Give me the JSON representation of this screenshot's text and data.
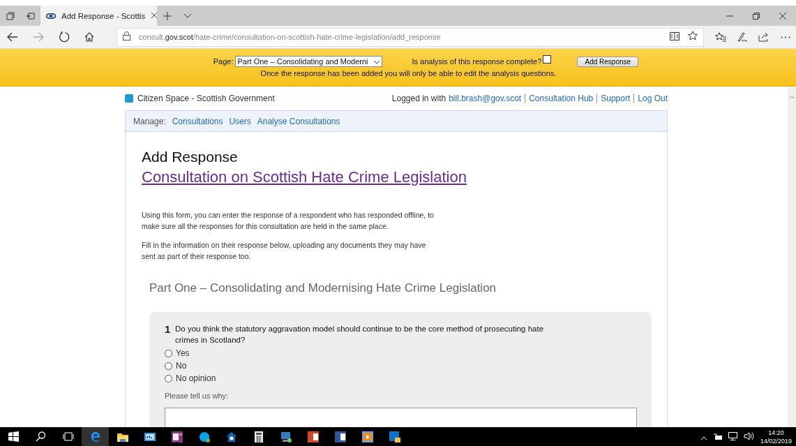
{
  "browser": {
    "tab": {
      "title": "Add Response - Scottis",
      "selected": true
    },
    "url": {
      "prefix": "consult.",
      "domain": "gov.scot",
      "path": "/hate-crime/consultation-on-scottish-hate-crime-legislation/add_response"
    }
  },
  "banner": {
    "page_label": "Page:",
    "page_select": "Part One – Consolidating and Moderni",
    "question": "Is analysis of this response complete?",
    "analysis_complete": false,
    "button": "Add Response",
    "note": "Once the response has been added you will only be able to edit the analysis questions."
  },
  "header": {
    "site": "Citizen Space - Scottish Government",
    "logged_in": "Logged in with",
    "user": "bill.brash@gov.scot",
    "links": [
      "Consultation Hub",
      "Support",
      "Log Out"
    ]
  },
  "manage": {
    "label": "Manage:",
    "links": [
      "Consultations",
      "Users",
      "Analyse Consultations"
    ]
  },
  "main": {
    "title": "Add Response",
    "consultation": "Consultation on Scottish Hate Crime Legislation",
    "paragraphs": [
      "Using this form, you can enter the response of a respondent who has responded offline, to make sure all the responses for this consultation are held in the same place.",
      "Fill in the information on their response below, uploading any documents they may have sent as part of their response too."
    ],
    "section": "Part One – Consolidating and Modernising Hate Crime Legislation",
    "question": {
      "number": "1",
      "text": "Do you think the statutory aggravation model should continue to be the core method of prosecuting hate crimes in Scotland?",
      "options": [
        {
          "label": "Yes",
          "selected": false
        },
        {
          "label": "No",
          "selected": false
        },
        {
          "label": "No opinion",
          "selected": false
        }
      ],
      "why_label": "Please tell us why:"
    }
  },
  "taskbar": {
    "time": "14:20",
    "date": "14/02/2019"
  }
}
